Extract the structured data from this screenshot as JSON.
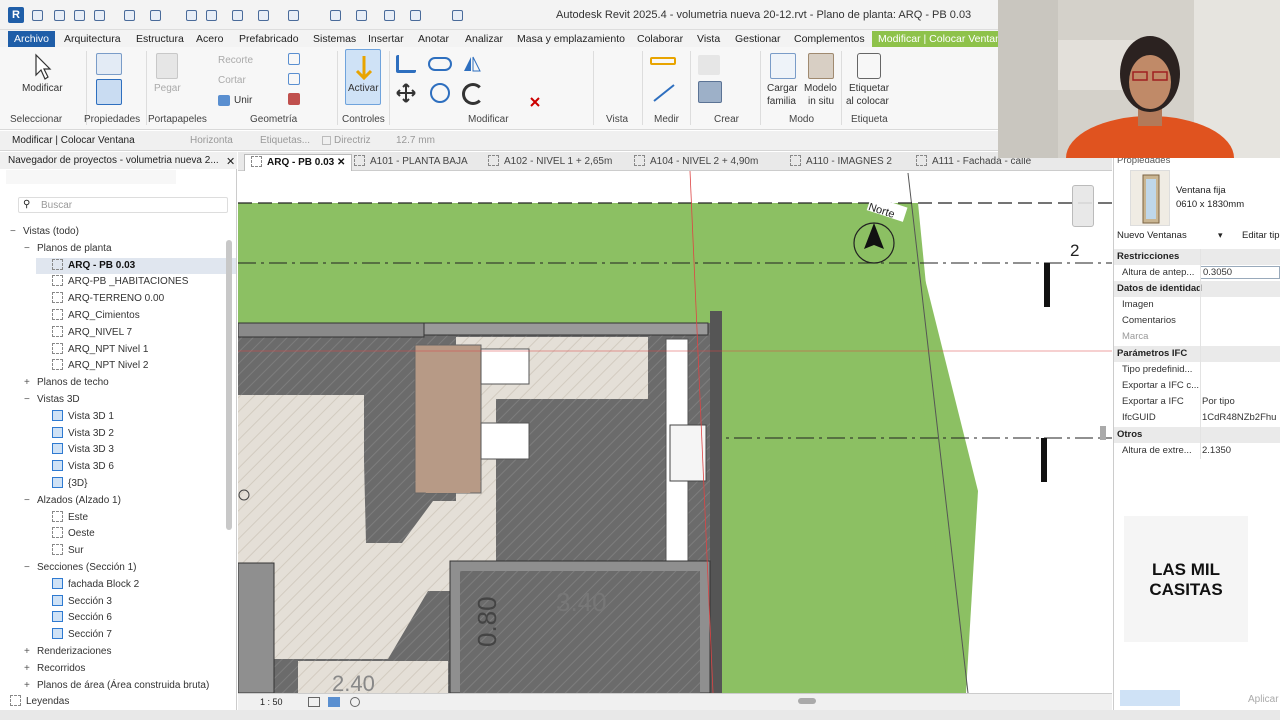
{
  "app": {
    "title": "Autodesk Revit 2025.4 - volumetria nueva 20-12.rvt - Plano de planta: ARQ - PB 0.03"
  },
  "ribbon": {
    "tabs": [
      "Archivo",
      "Arquitectura",
      "Estructura",
      "Acero",
      "Prefabricado",
      "Sistemas",
      "Insertar",
      "Anotar",
      "Analizar",
      "Masa y emplazamiento",
      "Colaborar",
      "Vista",
      "Gestionar",
      "Complementos",
      "Modificar | Colocar Ventana"
    ],
    "panels": {
      "seleccionar": "Seleccionar",
      "propiedades": "Propiedades",
      "portapapeles": "Portapapeles",
      "geometria": "Geometría",
      "controles": "Controles",
      "modificar": "Modificar",
      "vista": "Vista",
      "medir": "Medir",
      "crear": "Crear",
      "modo": "Modo",
      "etiqueta": "Etiqueta"
    },
    "buttons": {
      "modificar": "Modificar",
      "pegar": "Pegar",
      "recorte": "Recorte",
      "cortar": "Cortar",
      "unir": "Unir",
      "activar": "Activar",
      "cargar1": "Cargar",
      "cargar2": "familia",
      "modelo1": "Modelo",
      "modelo2": "in situ",
      "etiq1": "Etiquetar",
      "etiq2": "al colocar"
    }
  },
  "options_bar": {
    "context": "Modificar | Colocar Ventana",
    "orientation": "Horizonta",
    "tags": "Etiquetas...",
    "leader": "Directriz",
    "length": "12.7 mm"
  },
  "browser": {
    "header": "Navegador de proyectos - volumetria nueva 2...",
    "search_placeholder": "Buscar",
    "items": [
      {
        "label": "Vistas (todo)",
        "level": 0,
        "exp": "−",
        "icon": "none"
      },
      {
        "label": "Planos de planta",
        "level": 1,
        "exp": "−",
        "icon": "none"
      },
      {
        "label": "ARQ - PB 0.03",
        "level": 2,
        "exp": "",
        "icon": "plan",
        "sel": true
      },
      {
        "label": "ARQ-PB _HABITACIONES",
        "level": 2,
        "exp": "",
        "icon": "plan"
      },
      {
        "label": "ARQ-TERRENO 0.00",
        "level": 2,
        "exp": "",
        "icon": "plan"
      },
      {
        "label": "ARQ_Cimientos",
        "level": 2,
        "exp": "",
        "icon": "plan"
      },
      {
        "label": "ARQ_NIVEL 7",
        "level": 2,
        "exp": "",
        "icon": "plan"
      },
      {
        "label": "ARQ_NPT Nivel 1",
        "level": 2,
        "exp": "",
        "icon": "plan"
      },
      {
        "label": "ARQ_NPT Nivel 2",
        "level": 2,
        "exp": "",
        "icon": "plan"
      },
      {
        "label": "Planos de techo",
        "level": 1,
        "exp": "+",
        "icon": "none"
      },
      {
        "label": "Vistas 3D",
        "level": 1,
        "exp": "−",
        "icon": "none"
      },
      {
        "label": "Vista 3D 1",
        "level": 2,
        "exp": "",
        "icon": "3d"
      },
      {
        "label": "Vista 3D 2",
        "level": 2,
        "exp": "",
        "icon": "3d"
      },
      {
        "label": "Vista 3D 3",
        "level": 2,
        "exp": "",
        "icon": "3d"
      },
      {
        "label": "Vista 3D 6",
        "level": 2,
        "exp": "",
        "icon": "3d"
      },
      {
        "label": "{3D}",
        "level": 2,
        "exp": "",
        "icon": "3d"
      },
      {
        "label": "Alzados (Alzado 1)",
        "level": 1,
        "exp": "−",
        "icon": "none"
      },
      {
        "label": "Este",
        "level": 2,
        "exp": "",
        "icon": "plan"
      },
      {
        "label": "Oeste",
        "level": 2,
        "exp": "",
        "icon": "plan"
      },
      {
        "label": "Sur",
        "level": 2,
        "exp": "",
        "icon": "plan"
      },
      {
        "label": "Secciones (Sección 1)",
        "level": 1,
        "exp": "−",
        "icon": "none"
      },
      {
        "label": "fachada Block 2",
        "level": 2,
        "exp": "",
        "icon": "3d"
      },
      {
        "label": "Sección 3",
        "level": 2,
        "exp": "",
        "icon": "3d"
      },
      {
        "label": "Sección 6",
        "level": 2,
        "exp": "",
        "icon": "3d"
      },
      {
        "label": "Sección 7",
        "level": 2,
        "exp": "",
        "icon": "3d"
      },
      {
        "label": "Renderizaciones",
        "level": 1,
        "exp": "+",
        "icon": "none"
      },
      {
        "label": "Recorridos",
        "level": 1,
        "exp": "+",
        "icon": "none"
      },
      {
        "label": "Planos de área (Área construida bruta)",
        "level": 1,
        "exp": "+",
        "icon": "none"
      },
      {
        "label": "Leyendas",
        "level": 0,
        "exp": "",
        "icon": "plan"
      }
    ]
  },
  "view_tabs": [
    {
      "label": "ARQ - PB 0.03",
      "active": true
    },
    {
      "label": "A101 - PLANTA BAJA"
    },
    {
      "label": "A102 - NIVEL 1 + 2,65m"
    },
    {
      "label": "A104 - NIVEL 2 + 4,90m"
    },
    {
      "label": "A110 - IMAGNES 2"
    },
    {
      "label": "A111 - Fachada - calle"
    }
  ],
  "canvas": {
    "north_label": "Norte",
    "grid_label": "2",
    "room_area": "3.40",
    "room_dim": "0.80",
    "room_area2": "2.40",
    "scale": "1 : 50"
  },
  "properties": {
    "header": "Propiedades",
    "type_name": "Ventana fija",
    "type_size": "0610 x 1830mm",
    "type_selector": "Nuevo Ventanas",
    "edit_type": "Editar tip",
    "groups": {
      "restricciones": "Restricciones",
      "identidad": "Datos de identidad",
      "ifc": "Parámetros IFC",
      "otros": "Otros"
    },
    "rows": {
      "altura_antepecho": {
        "k": "Altura de antep...",
        "v": "0.3050"
      },
      "imagen": {
        "k": "Imagen",
        "v": ""
      },
      "comentarios": {
        "k": "Comentarios",
        "v": ""
      },
      "marca": {
        "k": "Marca",
        "v": ""
      },
      "tipo_predef": {
        "k": "Tipo predefinid...",
        "v": ""
      },
      "exportar_ifc_c": {
        "k": "Exportar a IFC c...",
        "v": ""
      },
      "exportar_ifc": {
        "k": "Exportar a IFC",
        "v": "Por tipo"
      },
      "ifcguid": {
        "k": "IfcGUID",
        "v": "1CdR48NZb2Fhu"
      },
      "altura_extremo": {
        "k": "Altura de extre...",
        "v": "2.1350"
      }
    },
    "apply": "Aplicar"
  },
  "brand": {
    "line1": "LAS MIL",
    "line2": "CASITAS"
  },
  "colors": {
    "accent": "#1f5ea8",
    "context_tab": "#8ec24a",
    "grass": "#8cc063",
    "wall": "#6e6e6e",
    "floor": "#d8d2c8"
  }
}
